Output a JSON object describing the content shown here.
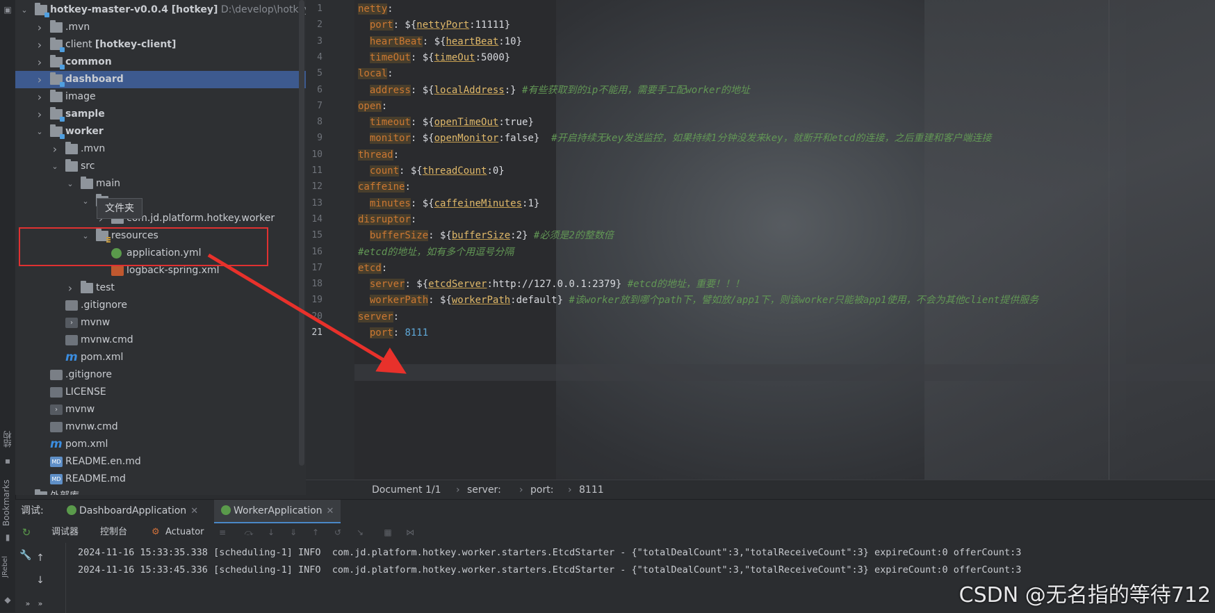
{
  "colors": {
    "selection": "#3d5a8f",
    "annotation": "#e03131",
    "keyword": "#cc7832",
    "comment": "#629755",
    "number": "#5fa8d8"
  },
  "left_strip": {
    "structure_label": "结构",
    "bookmarks_label": "Bookmarks",
    "jrebel_label": "JRebel"
  },
  "tree": [
    {
      "depth": 0,
      "arrow": "down",
      "icon": "module-folder-icon",
      "label": "hotkey-master-v0.0.4 [hotkey]",
      "suffix": "D:\\develop\\hotkey-ma",
      "bold": true
    },
    {
      "depth": 1,
      "arrow": "right",
      "icon": "folder-icon",
      "label": ".mvn"
    },
    {
      "depth": 1,
      "arrow": "right",
      "icon": "module-folder-icon",
      "label": "client [hotkey-client]",
      "bold": true,
      "bold_part": "[hotkey-client]"
    },
    {
      "depth": 1,
      "arrow": "right",
      "icon": "module-folder-icon",
      "label": "common",
      "bold": true
    },
    {
      "depth": 1,
      "arrow": "right",
      "icon": "module-folder-icon",
      "label": "dashboard",
      "bold": true,
      "selected": true
    },
    {
      "depth": 1,
      "arrow": "right",
      "icon": "folder-icon",
      "label": "image"
    },
    {
      "depth": 1,
      "arrow": "right",
      "icon": "module-folder-icon",
      "label": "sample",
      "bold": true
    },
    {
      "depth": 1,
      "arrow": "down",
      "icon": "module-folder-icon",
      "label": "worker",
      "bold": true
    },
    {
      "depth": 2,
      "arrow": "right",
      "icon": "folder-icon",
      "label": ".mvn"
    },
    {
      "depth": 2,
      "arrow": "down",
      "icon": "folder-icon",
      "label": "src"
    },
    {
      "depth": 3,
      "arrow": "down",
      "icon": "folder-icon",
      "label": "main"
    },
    {
      "depth": 4,
      "arrow": "down",
      "icon": "folder-icon",
      "label": ""
    },
    {
      "depth": 5,
      "arrow": "right",
      "icon": "package-icon",
      "label": "com.jd.platform.hotkey.worker"
    },
    {
      "depth": 4,
      "arrow": "down",
      "icon": "resources-folder-icon",
      "label": "resources"
    },
    {
      "depth": 5,
      "arrow": "",
      "icon": "yml-file-icon",
      "label": "application.yml"
    },
    {
      "depth": 5,
      "arrow": "",
      "icon": "xml-file-icon",
      "label": "logback-spring.xml"
    },
    {
      "depth": 3,
      "arrow": "right",
      "icon": "folder-icon",
      "label": "test"
    },
    {
      "depth": 2,
      "arrow": "",
      "icon": "gitignore-file-icon",
      "label": ".gitignore"
    },
    {
      "depth": 2,
      "arrow": "",
      "icon": "terminal-file-icon",
      "label": "mvnw"
    },
    {
      "depth": 2,
      "arrow": "",
      "icon": "text-file-icon",
      "label": "mvnw.cmd"
    },
    {
      "depth": 2,
      "arrow": "",
      "icon": "maven-file-icon",
      "label": "pom.xml"
    },
    {
      "depth": 1,
      "arrow": "",
      "icon": "gitignore-file-icon",
      "label": ".gitignore"
    },
    {
      "depth": 1,
      "arrow": "",
      "icon": "text-file-icon",
      "label": "LICENSE"
    },
    {
      "depth": 1,
      "arrow": "",
      "icon": "terminal-file-icon",
      "label": "mvnw"
    },
    {
      "depth": 1,
      "arrow": "",
      "icon": "text-file-icon",
      "label": "mvnw.cmd"
    },
    {
      "depth": 1,
      "arrow": "",
      "icon": "maven-file-icon",
      "label": "pom.xml"
    },
    {
      "depth": 1,
      "arrow": "",
      "icon": "markdown-file-icon",
      "label": "README.en.md"
    },
    {
      "depth": 1,
      "arrow": "",
      "icon": "markdown-file-icon",
      "label": "README.md"
    },
    {
      "depth": 0,
      "arrow": "right",
      "icon": "library-icon",
      "label": "外部库"
    }
  ],
  "tooltip": "文件夹",
  "editor": {
    "current_line": 21,
    "lines": [
      [
        [
          "k",
          "netty"
        ],
        [
          "p",
          ":"
        ]
      ],
      [
        [
          "p",
          "  "
        ],
        [
          "k",
          "port"
        ],
        [
          "p",
          ": ${"
        ],
        [
          "u",
          "nettyPort"
        ],
        [
          "v",
          ":11111}"
        ]
      ],
      [
        [
          "p",
          "  "
        ],
        [
          "k",
          "heartBeat"
        ],
        [
          "p",
          ": ${"
        ],
        [
          "u",
          "heartBeat"
        ],
        [
          "v",
          ":10}"
        ]
      ],
      [
        [
          "p",
          "  "
        ],
        [
          "k",
          "timeOut"
        ],
        [
          "p",
          ": ${"
        ],
        [
          "u",
          "timeOut"
        ],
        [
          "v",
          ":5000}"
        ]
      ],
      [
        [
          "k",
          "local"
        ],
        [
          "p",
          ":"
        ]
      ],
      [
        [
          "p",
          "  "
        ],
        [
          "k",
          "address"
        ],
        [
          "p",
          ": ${"
        ],
        [
          "u",
          "localAddress"
        ],
        [
          "v",
          ":} "
        ],
        [
          "c",
          "#有些获取到的ip不能用，需要手工配worker的地址"
        ]
      ],
      [
        [
          "k",
          "open"
        ],
        [
          "p",
          ":"
        ]
      ],
      [
        [
          "p",
          "  "
        ],
        [
          "k",
          "timeout"
        ],
        [
          "p",
          ": ${"
        ],
        [
          "u",
          "openTimeOut"
        ],
        [
          "v",
          ":true}"
        ]
      ],
      [
        [
          "p",
          "  "
        ],
        [
          "k",
          "monitor"
        ],
        [
          "p",
          ": ${"
        ],
        [
          "u",
          "openMonitor"
        ],
        [
          "v",
          ":false}  "
        ],
        [
          "c",
          "#开启持续无key发送监控，如果持续1分钟没发来key，就断开和etcd的连接，之后重建和客户端连接"
        ]
      ],
      [
        [
          "k",
          "thread"
        ],
        [
          "p",
          ":"
        ]
      ],
      [
        [
          "p",
          "  "
        ],
        [
          "k",
          "count"
        ],
        [
          "p",
          ": ${"
        ],
        [
          "u",
          "threadCount"
        ],
        [
          "v",
          ":0}"
        ]
      ],
      [
        [
          "k",
          "caffeine"
        ],
        [
          "p",
          ":"
        ]
      ],
      [
        [
          "p",
          "  "
        ],
        [
          "k",
          "minutes"
        ],
        [
          "p",
          ": ${"
        ],
        [
          "u",
          "caffeineMinutes"
        ],
        [
          "v",
          ":1}"
        ]
      ],
      [
        [
          "k",
          "disruptor"
        ],
        [
          "p",
          ":"
        ]
      ],
      [
        [
          "p",
          "  "
        ],
        [
          "k",
          "bufferSize"
        ],
        [
          "p",
          ": ${"
        ],
        [
          "u",
          "bufferSize"
        ],
        [
          "v",
          ":2} "
        ],
        [
          "c",
          "#必须是2的整数倍"
        ]
      ],
      [
        [
          "c",
          "#etcd的地址，如有多个用逗号分隔"
        ]
      ],
      [
        [
          "k",
          "etcd"
        ],
        [
          "p",
          ":"
        ]
      ],
      [
        [
          "p",
          "  "
        ],
        [
          "k",
          "server"
        ],
        [
          "p",
          ": ${"
        ],
        [
          "u",
          "etcdServer"
        ],
        [
          "v",
          ":http://127.0.0.1:2379} "
        ],
        [
          "c",
          "#etcd的地址，重要！！！"
        ]
      ],
      [
        [
          "p",
          "  "
        ],
        [
          "k",
          "workerPath"
        ],
        [
          "p",
          ": ${"
        ],
        [
          "u",
          "workerPath"
        ],
        [
          "v",
          ":default} "
        ],
        [
          "c",
          "#该worker放到哪个path下，譬如放/app1下，则该worker只能被app1使用，不会为其他client提供服务"
        ]
      ],
      [
        [
          "k",
          "server"
        ],
        [
          "p",
          ":"
        ]
      ],
      [
        [
          "p",
          "  "
        ],
        [
          "k",
          "port"
        ],
        [
          "p",
          ": "
        ],
        [
          "num",
          "8111"
        ]
      ]
    ],
    "breadcrumb": [
      "Document 1/1",
      "server:",
      "port:",
      "8111"
    ]
  },
  "debug": {
    "label": "调试:",
    "tabs": [
      {
        "label": "DashboardApplication",
        "active": false
      },
      {
        "label": "WorkerApplication",
        "active": true
      }
    ],
    "toolbar": {
      "debugger": "调试器",
      "console": "控制台",
      "actuator": "Actuator"
    },
    "log_lines": [
      "2024-11-16 15:33:35.338 [scheduling-1] INFO  com.jd.platform.hotkey.worker.starters.EtcdStarter - {\"totalDealCount\":3,\"totalReceiveCount\":3} expireCount:0 offerCount:3",
      "2024-11-16 15:33:45.336 [scheduling-1] INFO  com.jd.platform.hotkey.worker.starters.EtcdStarter - {\"totalDealCount\":3,\"totalReceiveCount\":3} expireCount:0 offerCount:3"
    ]
  },
  "watermark": "CSDN @无名指的等待712"
}
